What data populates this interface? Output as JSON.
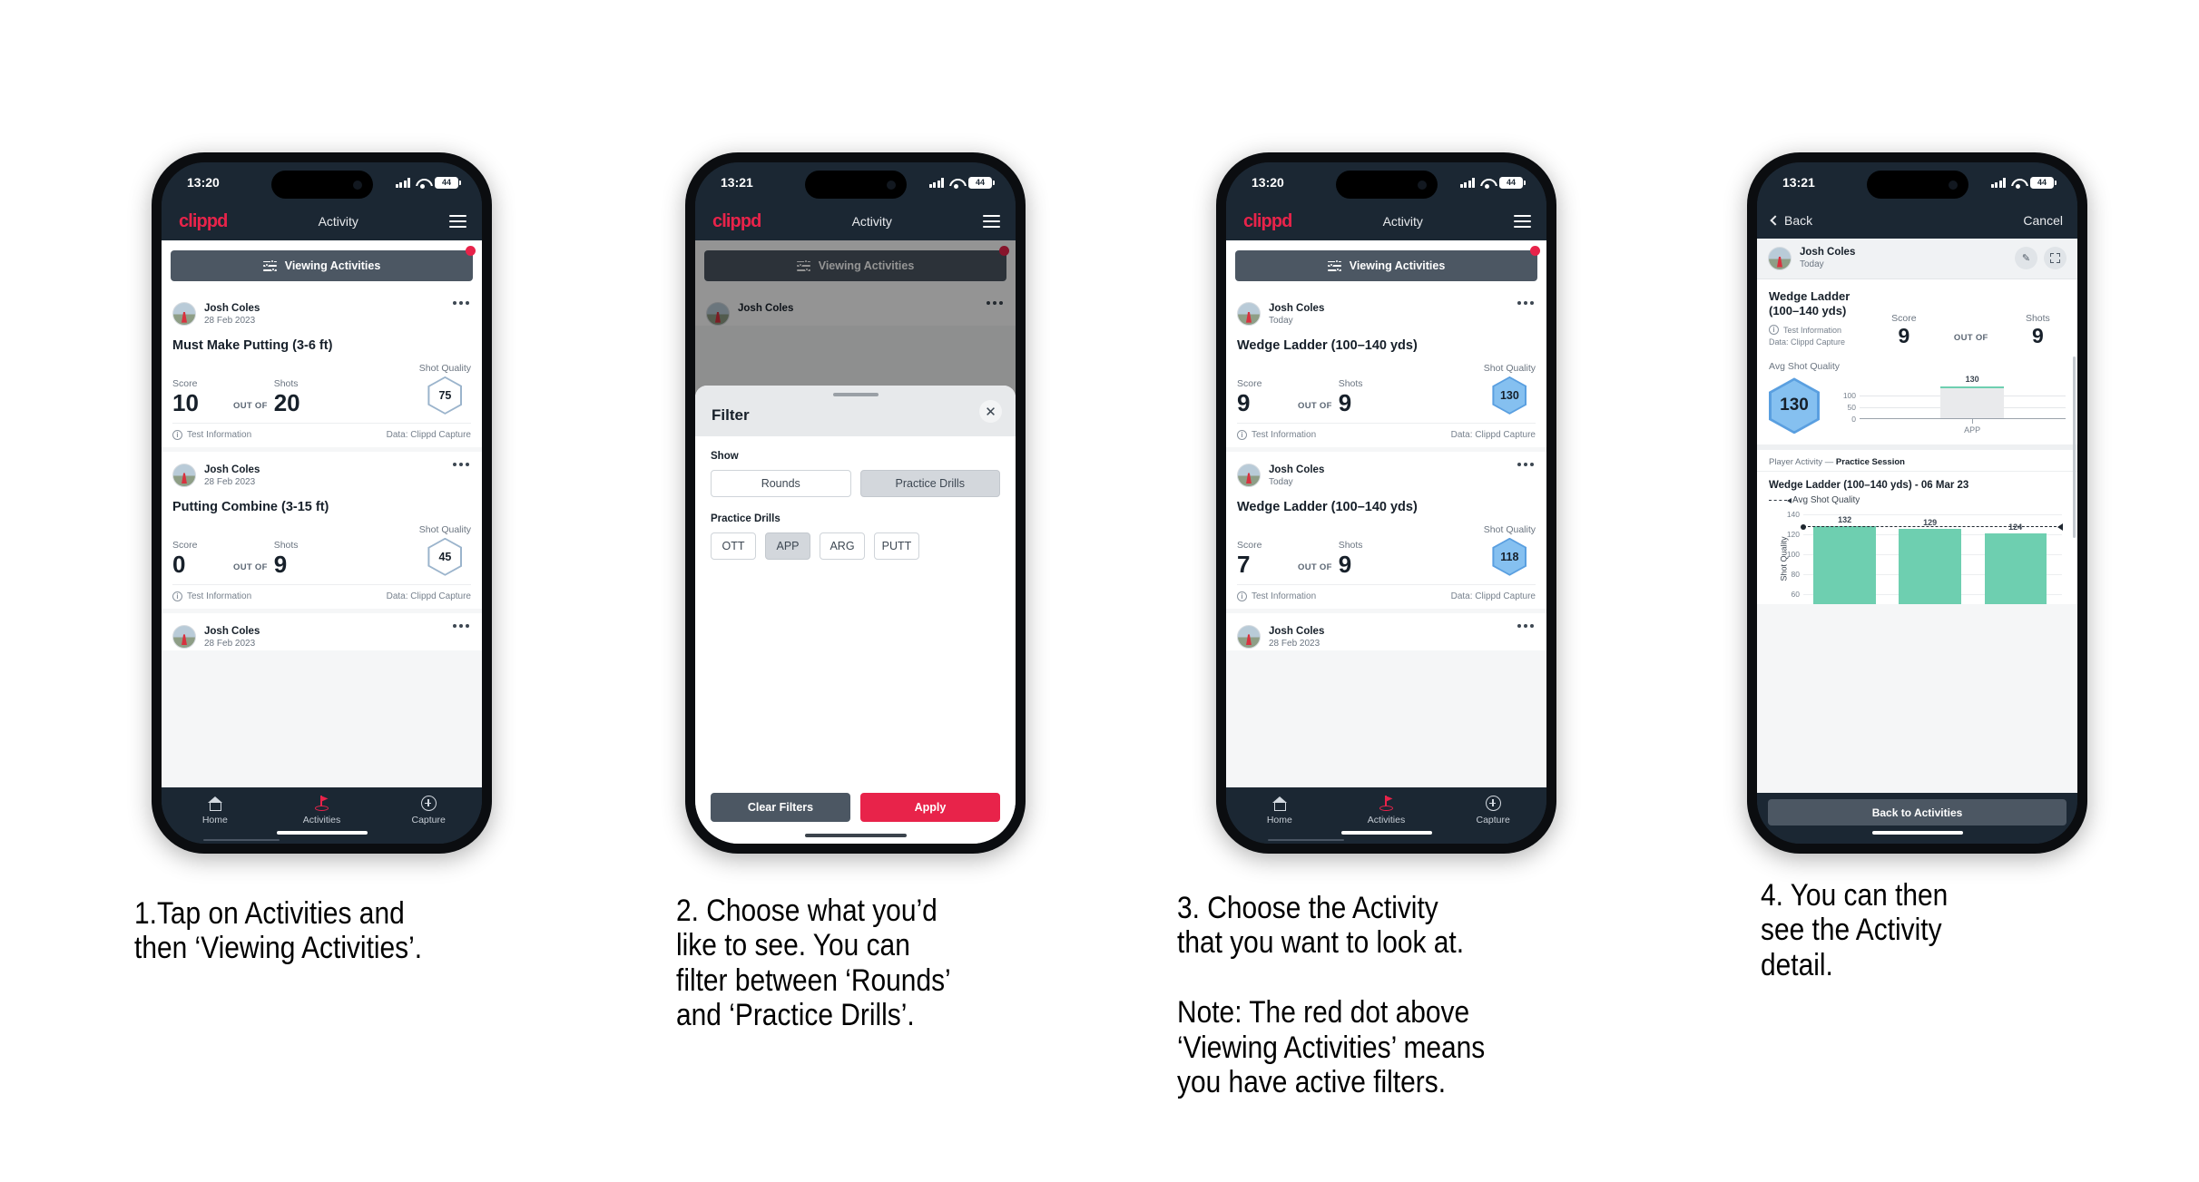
{
  "phones": [
    {
      "id": "phone-activities-list",
      "status": {
        "time": "13:20",
        "battery": "44"
      },
      "appbar": {
        "logo": "clippd",
        "title": "Activity",
        "menu_icon": "hamburger-icon"
      },
      "viewbar": {
        "label": "Viewing Activities",
        "icon": "filter-sliders-icon",
        "has_red_dot": true
      },
      "cards": [
        {
          "user": "Josh Coles",
          "date": "28 Feb 2023",
          "title": "Must Make Putting (3-6 ft)",
          "score_label": "Score",
          "shots_label": "Shots",
          "quality_label": "Shot Quality",
          "score": "10",
          "out_of": "OUT OF",
          "shots": "20",
          "quality": "75",
          "quality_style": "outline",
          "footer_left": "Test Information",
          "footer_right": "Data: Clippd Capture"
        },
        {
          "user": "Josh Coles",
          "date": "28 Feb 2023",
          "title": "Putting Combine (3-15 ft)",
          "score_label": "Score",
          "shots_label": "Shots",
          "quality_label": "Shot Quality",
          "score": "0",
          "out_of": "OUT OF",
          "shots": "9",
          "quality": "45",
          "quality_style": "outline",
          "footer_left": "Test Information",
          "footer_right": "Data: Clippd Capture"
        }
      ],
      "partial_card": {
        "user": "Josh Coles",
        "date": "28 Feb 2023"
      },
      "nav": [
        {
          "label": "Home",
          "icon": "home-icon",
          "active": false
        },
        {
          "label": "Activities",
          "icon": "golf-flag-icon",
          "active": true
        },
        {
          "label": "Capture",
          "icon": "plus-circle-icon",
          "active": false
        }
      ]
    },
    {
      "id": "phone-filter-sheet",
      "status": {
        "time": "13:21",
        "battery": "44"
      },
      "appbar": {
        "logo": "clippd",
        "title": "Activity",
        "menu_icon": "hamburger-icon"
      },
      "viewbar": {
        "label": "Viewing Activities",
        "icon": "filter-sliders-icon",
        "has_red_dot": true
      },
      "behind_card": {
        "user": "Josh Coles"
      },
      "sheet": {
        "title": "Filter",
        "close_icon": "close-icon",
        "show_label": "Show",
        "show_options": [
          {
            "label": "Rounds",
            "selected": false
          },
          {
            "label": "Practice Drills",
            "selected": true
          }
        ],
        "drills_label": "Practice Drills",
        "drill_options": [
          {
            "label": "OTT",
            "selected": false
          },
          {
            "label": "APP",
            "selected": true
          },
          {
            "label": "ARG",
            "selected": false
          },
          {
            "label": "PUTT",
            "selected": false
          }
        ],
        "clear_label": "Clear Filters",
        "apply_label": "Apply"
      }
    },
    {
      "id": "phone-filtered-activities",
      "status": {
        "time": "13:20",
        "battery": "44"
      },
      "appbar": {
        "logo": "clippd",
        "title": "Activity",
        "menu_icon": "hamburger-icon"
      },
      "viewbar": {
        "label": "Viewing Activities",
        "icon": "filter-sliders-icon",
        "has_red_dot": true
      },
      "cards": [
        {
          "user": "Josh Coles",
          "date": "Today",
          "title": "Wedge Ladder (100–140 yds)",
          "score_label": "Score",
          "shots_label": "Shots",
          "quality_label": "Shot Quality",
          "score": "9",
          "out_of": "OUT OF",
          "shots": "9",
          "quality": "130",
          "quality_style": "filled",
          "footer_left": "Test Information",
          "footer_right": "Data: Clippd Capture"
        },
        {
          "user": "Josh Coles",
          "date": "Today",
          "title": "Wedge Ladder (100–140 yds)",
          "score_label": "Score",
          "shots_label": "Shots",
          "quality_label": "Shot Quality",
          "score": "7",
          "out_of": "OUT OF",
          "shots": "9",
          "quality": "118",
          "quality_style": "filled",
          "footer_left": "Test Information",
          "footer_right": "Data: Clippd Capture"
        }
      ],
      "partial_card": {
        "user": "Josh Coles",
        "date": "28 Feb 2023"
      },
      "nav": [
        {
          "label": "Home",
          "icon": "home-icon",
          "active": false
        },
        {
          "label": "Activities",
          "icon": "golf-flag-icon",
          "active": true
        },
        {
          "label": "Capture",
          "icon": "plus-circle-icon",
          "active": false
        }
      ]
    },
    {
      "id": "phone-activity-detail",
      "status": {
        "time": "13:21",
        "battery": "44"
      },
      "appbar": {
        "back_label": "Back",
        "cancel_label": "Cancel",
        "back_icon": "chevron-left-icon"
      },
      "user": {
        "name": "Josh Coles",
        "date": "Today"
      },
      "actions": {
        "edit_icon": "pencil-icon",
        "expand_icon": "expand-icon"
      },
      "summary": {
        "title": "Wedge Ladder\n(100–140 yds)",
        "info_label": "Test Information",
        "data_label": "Data: Clippd Capture",
        "score_label": "Score",
        "shots_label": "Shots",
        "score": "9",
        "out_of": "OUT OF",
        "shots": "9"
      },
      "avg_quality": {
        "label": "Avg Shot Quality",
        "value": "130"
      },
      "session_label_prefix": "Player Activity — ",
      "session_label_bold": "Practice Session",
      "chart_title": "Wedge Ladder (100–140 yds) - 06 Mar 23",
      "legend_label": "Avg Shot Quality",
      "back_button": "Back to Activities"
    }
  ],
  "chart_data": [
    {
      "type": "bar",
      "title": "Avg Shot Quality",
      "categories": [
        "APP"
      ],
      "values": [
        130
      ],
      "data_labels": [
        "130"
      ],
      "ylabel": "",
      "yticks": [
        0,
        50,
        100
      ],
      "ytick_labels": [
        "0",
        "50",
        "100"
      ],
      "ylim": [
        0,
        140
      ],
      "grid": true,
      "legend": "none",
      "bar_color": "#6ecfb0",
      "bar_fill": "#e9eaec"
    },
    {
      "type": "bar",
      "title": "Wedge Ladder (100–140 yds) - 06 Mar 23",
      "categories": [
        "",
        "",
        ""
      ],
      "values": [
        132,
        129,
        124
      ],
      "data_labels": [
        "132",
        "129",
        "124"
      ],
      "ylabel": "Shot Quality",
      "yticks": [
        60,
        80,
        100,
        120,
        140
      ],
      "ytick_labels": [
        "60",
        "80",
        "100",
        "120",
        "140"
      ],
      "ylim": [
        55,
        145
      ],
      "grid": true,
      "legend": "Avg Shot Quality",
      "legend_position": "top-left",
      "annotations": [
        {
          "type": "average-line",
          "label": "Avg Shot Quality",
          "value": 130
        }
      ],
      "bar_color": "#6ecfb0"
    }
  ],
  "captions": [
    "1.Tap on Activities and\nthen ‘Viewing Activities’.",
    "2. Choose what you’d\nlike to see. You can\nfilter between ‘Rounds’\nand ‘Practice Drills’.",
    "3. Choose the Activity\nthat you want to look at.\n\nNote: The red dot above\n‘Viewing Activities’ means\nyou have active filters.",
    "4. You can then\nsee the Activity\ndetail."
  ]
}
